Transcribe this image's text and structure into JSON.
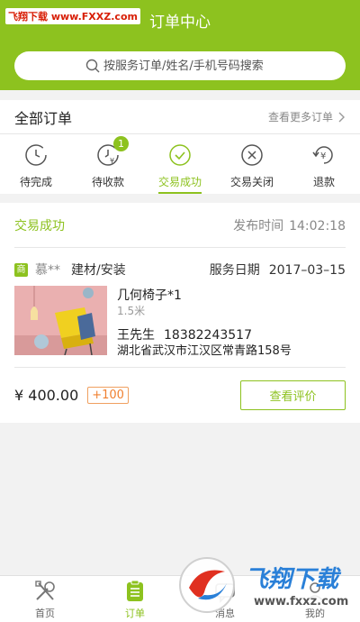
{
  "header": {
    "watermark": "飞翔下载 www.FXXZ.com",
    "title": "订单中心",
    "search_placeholder": "按服务订单/姓名/手机号码搜索"
  },
  "orders": {
    "title": "全部订单",
    "more_label": "查看更多订单",
    "tabs": [
      {
        "label": "待完成",
        "icon": "clock-icon"
      },
      {
        "label": "待收款",
        "icon": "yen-clock-icon",
        "badge": "1"
      },
      {
        "label": "交易成功",
        "icon": "check-circle-icon",
        "active": true
      },
      {
        "label": "交易关闭",
        "icon": "x-circle-icon"
      },
      {
        "label": "退款",
        "icon": "refund-icon"
      }
    ]
  },
  "order": {
    "status": "交易成功",
    "publish_label": "发布时间",
    "publish_time": "14:02:18",
    "shop_badge": "商",
    "customer": "慕**",
    "category": "建材/安装",
    "service_date_label": "服务日期",
    "service_date": "2017–03–15",
    "product_name": "几何椅子*1",
    "product_spec": "1.5米",
    "contact_name": "王先生",
    "contact_phone": "18382243517",
    "address": "湖北省武汉市江汉区常青路158号",
    "price": "¥ 400.00",
    "points": "+100",
    "review_button": "查看评价"
  },
  "bottom_nav": [
    {
      "label": "首页",
      "icon": "tools-icon"
    },
    {
      "label": "订单",
      "icon": "clipboard-icon",
      "active": true
    },
    {
      "label": "消息",
      "icon": "message-icon"
    },
    {
      "label": "我的",
      "icon": "user-icon"
    }
  ],
  "watermark_logo": {
    "text": "飞翔下载",
    "url": "www.fxxz.com"
  },
  "colors": {
    "brand_green": "#8dc21f",
    "points_orange": "#f08030"
  }
}
